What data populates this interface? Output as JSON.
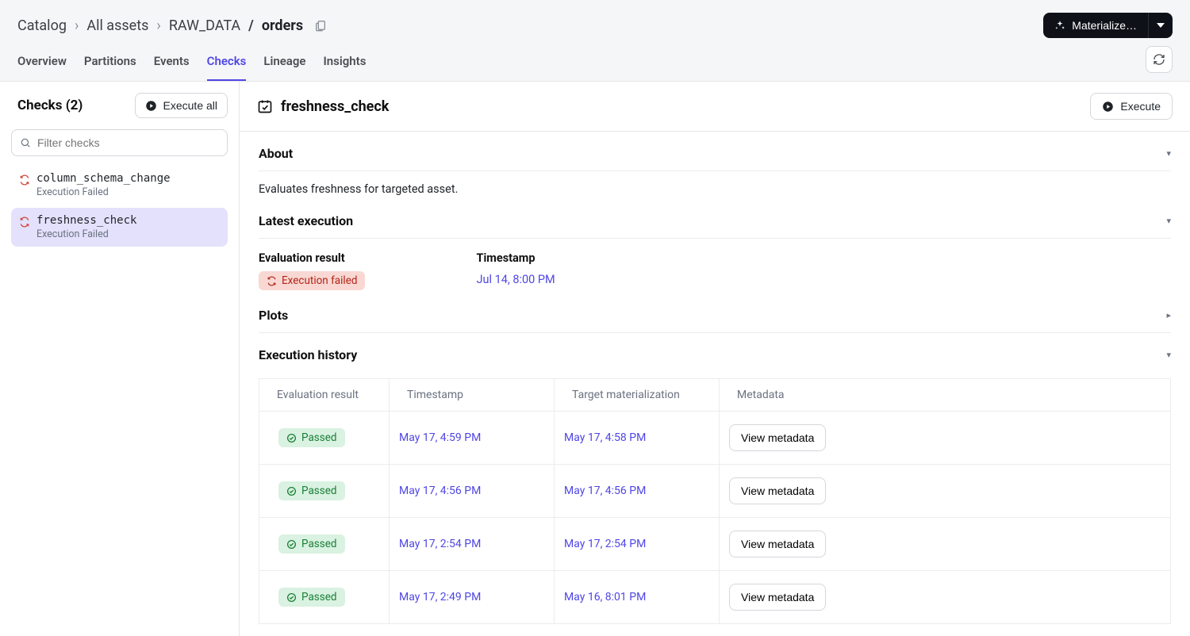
{
  "breadcrumb": {
    "root": "Catalog",
    "level1": "All assets",
    "path_prefix": "RAW_DATA",
    "path_sep": "/",
    "asset": "orders"
  },
  "buttons": {
    "materialize": "Materialize…",
    "execute_all": "Execute all",
    "execute": "Execute",
    "view_metadata": "View metadata"
  },
  "tabs": [
    "Overview",
    "Partitions",
    "Events",
    "Checks",
    "Lineage",
    "Insights"
  ],
  "active_tab": "Checks",
  "sidebar": {
    "title": "Checks (2)",
    "filter_placeholder": "Filter checks",
    "items": [
      {
        "name": "column_schema_change",
        "status": "Execution Failed",
        "selected": false
      },
      {
        "name": "freshness_check",
        "status": "Execution Failed",
        "selected": true
      }
    ]
  },
  "detail": {
    "title": "freshness_check",
    "about_heading": "About",
    "about_body": "Evaluates freshness for targeted asset.",
    "latest_heading": "Latest execution",
    "eval_label": "Evaluation result",
    "eval_badge": "Execution failed",
    "ts_label": "Timestamp",
    "ts_value": "Jul 14, 8:00 PM",
    "plots_heading": "Plots",
    "history_heading": "Execution history",
    "history_columns": [
      "Evaluation result",
      "Timestamp",
      "Target materialization",
      "Metadata"
    ],
    "history_rows": [
      {
        "result": "Passed",
        "timestamp": "May 17, 4:59 PM",
        "target": "May 17, 4:58 PM"
      },
      {
        "result": "Passed",
        "timestamp": "May 17, 4:56 PM",
        "target": "May 17, 4:56 PM"
      },
      {
        "result": "Passed",
        "timestamp": "May 17, 2:54 PM",
        "target": "May 17, 2:54 PM"
      },
      {
        "result": "Passed",
        "timestamp": "May 17, 2:49 PM",
        "target": "May 16, 8:01 PM"
      }
    ]
  }
}
